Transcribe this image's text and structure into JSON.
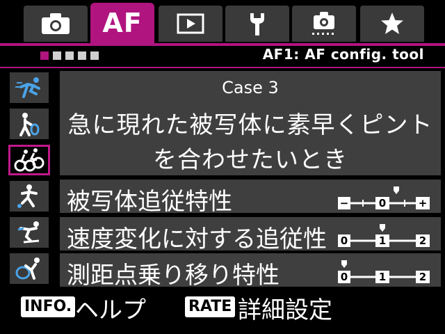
{
  "tabs": [
    {
      "name": "camera-icon",
      "label": ""
    },
    {
      "name": "af",
      "label": "AF"
    },
    {
      "name": "play-icon",
      "label": ""
    },
    {
      "name": "wrench-icon",
      "label": ""
    },
    {
      "name": "custom-camera-icon",
      "label": ""
    },
    {
      "name": "star-icon",
      "label": ""
    }
  ],
  "subheader": {
    "title": "AF1: AF config. tool",
    "page_count": 5,
    "active_page": 1
  },
  "cases": [
    {
      "icon": "runner-icon"
    },
    {
      "icon": "tennis-player-icon"
    },
    {
      "icon": "cyclists-icon",
      "active": true
    },
    {
      "icon": "soccer-player-icon"
    },
    {
      "icon": "skier-icon"
    },
    {
      "icon": "gymnast-icon"
    }
  ],
  "description": {
    "case_name": "Case 3",
    "line1": "急に現れた被写体に素早くピント",
    "line2": "を合わせたいとき"
  },
  "params": [
    {
      "label": "被写体追従特性",
      "scale_labels": [
        "−",
        "0",
        "+"
      ],
      "value": 0.5
    },
    {
      "label": "速度変化に対する追従性",
      "scale_labels": [
        "0",
        "1",
        "2"
      ],
      "value": 1
    },
    {
      "label": "測距点乗り移り特性",
      "scale_labels": [
        "0",
        "1",
        "2"
      ],
      "value": 0
    }
  ],
  "footer": {
    "info_badge": "INFO.",
    "info_label": "ヘルプ",
    "rate_badge": "RATE",
    "rate_label": "詳細設定"
  },
  "colors": {
    "accent": "#b0147f",
    "panel": "#3f3f3f",
    "tab": "#3a3a3a",
    "icon_blue": "#4aa3e8"
  }
}
